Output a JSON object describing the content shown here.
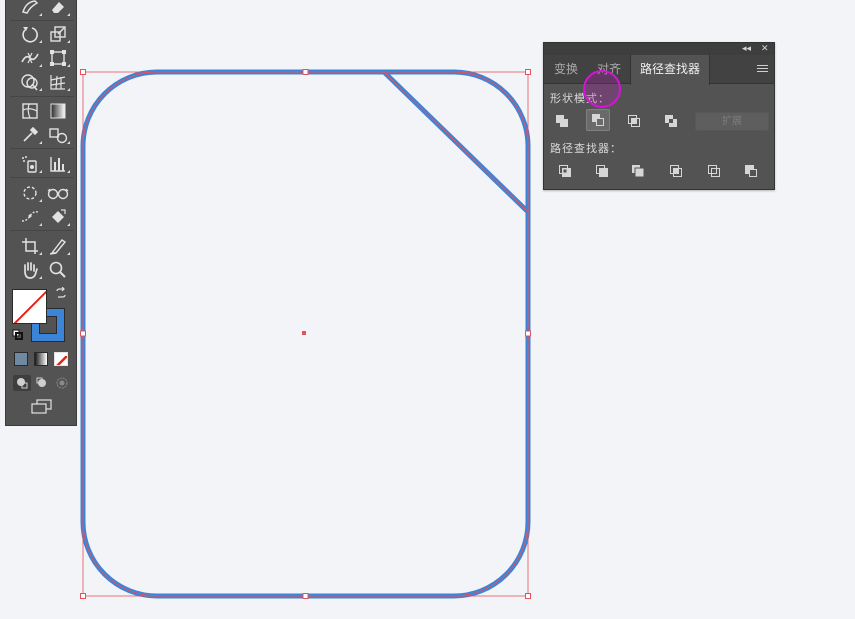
{
  "panel": {
    "collapse_glyph": "◂◂",
    "close_glyph": "✕",
    "tabs": [
      {
        "label": "变换",
        "active": false
      },
      {
        "label": "对齐",
        "active": false
      },
      {
        "label": "路径查找器",
        "active": true
      }
    ],
    "shape_modes_label": "形状模式：",
    "pathfinders_label": "路径查找器：",
    "expand_label": "扩展",
    "shape_mode_buttons": [
      "unite-icon",
      "minus-front-icon",
      "intersect-icon",
      "exclude-icon"
    ],
    "pathfinder_buttons": [
      "divide-icon",
      "trim-icon",
      "merge-icon",
      "crop-icon",
      "outline-icon",
      "minus-back-icon"
    ],
    "selected_shape_mode": "minus-front-icon"
  },
  "toolbar": {
    "tools": [
      "blob-brush-icon",
      "eraser-icon",
      "rotate-icon",
      "scale-icon",
      "width-icon",
      "free-transform-icon",
      "shape-builder-icon",
      "perspective-grid-icon",
      "mesh-icon",
      "gradient-icon",
      "eyedropper-icon",
      "blend-icon",
      "symbol-sprayer-icon",
      "column-graph-icon",
      "artboard-icon",
      "slice-icon",
      "hand-icon",
      "zoom-icon"
    ],
    "fill_color": "#ffffff",
    "stroke_color": "#3c84d8"
  },
  "colors": {
    "accent_stroke": "#3c84d8",
    "selection_red": "#e8505b",
    "cursor_magenta": "#d614d6",
    "canvas": "#f3f4f8"
  }
}
